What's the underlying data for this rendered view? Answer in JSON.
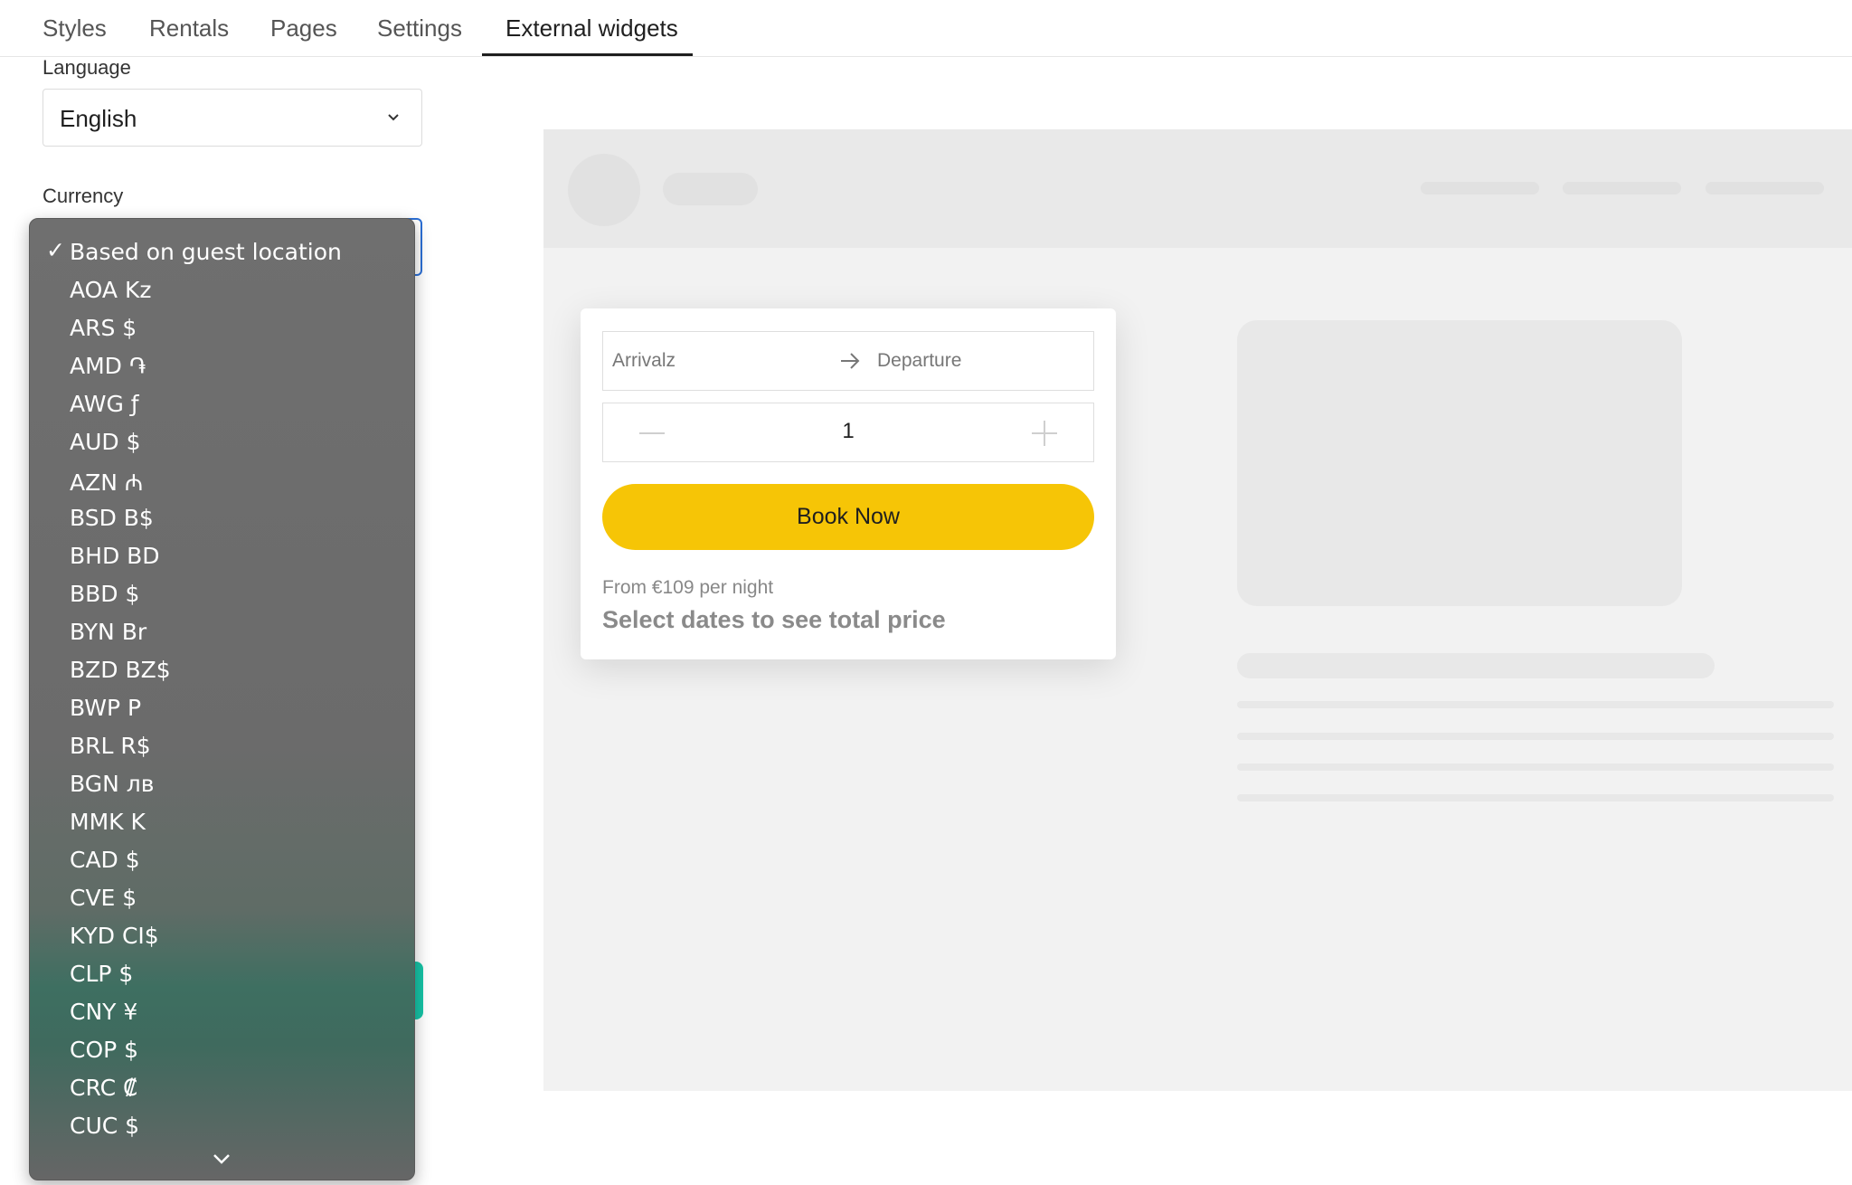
{
  "tabs": [
    {
      "label": "Styles"
    },
    {
      "label": "Rentals"
    },
    {
      "label": "Pages"
    },
    {
      "label": "Settings"
    },
    {
      "label": "External widgets",
      "active": true
    }
  ],
  "settings": {
    "language_label": "Language",
    "language_value": "English",
    "currency_label": "Currency"
  },
  "currency_menu": {
    "selected": "Based on guest location",
    "options": [
      "Based on guest location",
      "AOA Kz",
      "ARS $",
      "AMD ֏",
      "AWG ƒ",
      "AUD $",
      "AZN ₼",
      "BSD B$",
      "BHD BD",
      "BBD $",
      "BYN Br",
      "BZD BZ$",
      "BWP P",
      "BRL R$",
      "BGN лв",
      "MMK K",
      "CAD $",
      "CVE $",
      "KYD CI$",
      "CLP $",
      "CNY ¥",
      "COP $",
      "CRC ₡",
      "CUC $"
    ],
    "check_icon": "✓",
    "scroll_icon": "chevron-down-icon"
  },
  "widget": {
    "arrival_placeholder": "Arrivalz",
    "departure_placeholder": "Departure",
    "quantity": "1",
    "book_button": "Book Now",
    "from_price": "From €109 per night",
    "select_hint": "Select dates to see total price",
    "accent": "#f6c506"
  },
  "colors": {
    "focus_border": "#2b6fd6",
    "teal_button": "#17c4a7"
  }
}
